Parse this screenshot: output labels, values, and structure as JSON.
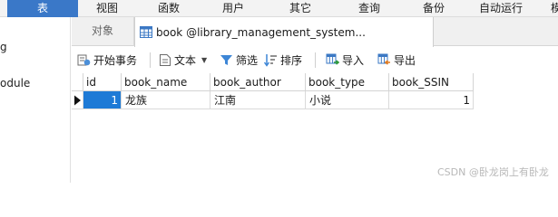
{
  "menu": {
    "items": [
      "表",
      "视图",
      "函数",
      "用户",
      "其它",
      "查询",
      "备份",
      "自动运行",
      "模"
    ]
  },
  "left_panel": {
    "items": [
      "g",
      "odule"
    ]
  },
  "tabs": {
    "objects_label": "对象",
    "table_tab_label": "book @library_management_system..."
  },
  "toolbar": {
    "begin_transaction": "开始事务",
    "text": "文本",
    "filter": "筛选",
    "sort": "排序",
    "import": "导入",
    "export": "导出"
  },
  "grid": {
    "columns": [
      "id",
      "book_name",
      "book_author",
      "book_type",
      "book_SSIN"
    ],
    "rows": [
      {
        "id": "1",
        "book_name": "龙族",
        "book_author": "江南",
        "book_type": "小说",
        "book_SSIN": "1"
      }
    ]
  },
  "watermark": "CSDN @卧龙岗上有卧龙",
  "colors": {
    "accent": "#3a78c8",
    "selection": "#1e7ad6"
  }
}
